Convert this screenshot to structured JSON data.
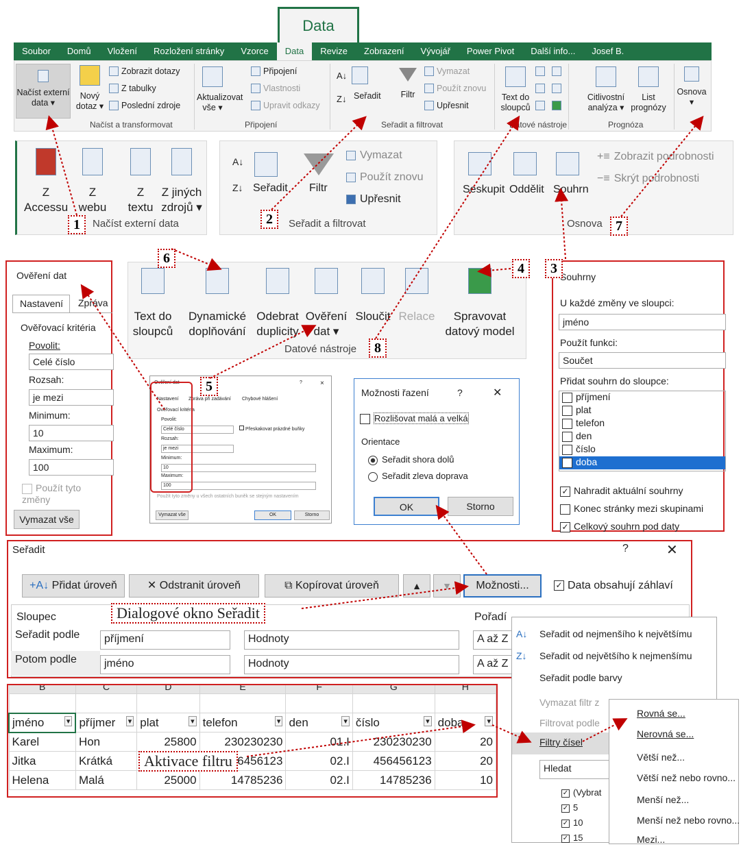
{
  "ribbon": {
    "data_tab_big": "Data",
    "tabs": [
      "Soubor",
      "Domů",
      "Vložení",
      "Rozložení stránky",
      "Vzorce",
      "Data",
      "Revize",
      "Zobrazení",
      "Vývojář",
      "Power Pivot",
      "Další info...",
      "Josef B."
    ],
    "btn_nacist": [
      "Načíst externí",
      "data ▾"
    ],
    "btn_novy": [
      "Nový",
      "dotaz ▾"
    ],
    "zobrazit_dotazy": "Zobrazit dotazy",
    "z_tabulky": "Z tabulky",
    "posledni_zdroje": "Poslední zdroje",
    "grp_nacist": "Načíst a transformovat",
    "btn_aktualizovat": [
      "Aktualizovat",
      "vše ▾"
    ],
    "pripojeni": "Připojení",
    "vlastnosti": "Vlastnosti",
    "upravit_odkazy": "Upravit odkazy",
    "grp_pripojeni": "Připojení",
    "seradit": "Seřadit",
    "filtr": "Filtr",
    "vymazat": "Vymazat",
    "pouzit_znovu": "Použít znovu",
    "upresnit": "Upřesnit",
    "grp_seradit": "Seřadit a filtrovat",
    "text_do_sloupcu": [
      "Text do",
      "sloupců"
    ],
    "grp_datove": "Datové nástroje",
    "citlivostni": [
      "Citlivostní",
      "analýza ▾"
    ],
    "list_prognozy": [
      "List",
      "prognózy"
    ],
    "grp_prognoza": "Prognóza",
    "osnova": "Osnova"
  },
  "p1": {
    "items": [
      [
        "Z",
        "Accessu"
      ],
      [
        "Z",
        "webu"
      ],
      [
        "Z",
        "textu"
      ],
      [
        "Z jiných",
        "zdrojů ▾"
      ]
    ],
    "label": "Načíst externí data",
    "num": "1"
  },
  "p2": {
    "seradit": "Seřadit",
    "filtr": "Filtr",
    "vymazat": "Vymazat",
    "pouzit_znovu": "Použít znovu",
    "upresnit": "Upřesnit",
    "label": "Seřadit a filtrovat",
    "num": "2"
  },
  "p7": {
    "seskupit": "Seskupit",
    "oddelit": "Oddělit",
    "souhrn": "Souhrn",
    "zobrazit": "Zobrazit podrobnosti",
    "skryt": "Skrýt podrobnosti",
    "label": "Osnova",
    "num": "7"
  },
  "p4": {
    "items": [
      [
        "Text do",
        "sloupců"
      ],
      [
        "Dynamické",
        "doplňování"
      ],
      [
        "Odebrat",
        "duplicity"
      ],
      [
        "Ověření",
        "dat ▾"
      ],
      [
        "Sloučit",
        ""
      ],
      [
        "Relace",
        ""
      ],
      [
        "Spravovat",
        "datový model"
      ]
    ],
    "label": "Datové nástroje",
    "num6": "6",
    "num4": "4",
    "num8": "8"
  },
  "overeni": {
    "title": "Ověření dat",
    "tab1": "Nastavení",
    "tab2": "Zpráva",
    "krit": "Ověřovací kritéria",
    "povolit": "Povolit:",
    "povolit_v": "Celé číslo",
    "rozsah": "Rozsah:",
    "rozsah_v": "je mezi",
    "min": "Minimum:",
    "min_v": "10",
    "max": "Maximum:",
    "max_v": "100",
    "pouzit": "Použít tyto změny",
    "vymazat": "Vymazat vše"
  },
  "small_dlg": {
    "title": "Ověření dat",
    "q": "?",
    "x": "×",
    "tabs": [
      "Nastavení",
      "Zpráva při zadávání",
      "Chybové hlášení"
    ],
    "krit": "Ověřovací kritéria",
    "povolit": "Povolit:",
    "povolit_v": "Celé číslo",
    "preskakovat": "Přeskakovat prázdné buňky",
    "rozsah": "Rozsah:",
    "rozsah_v": "je mezi",
    "min": "Minimum:",
    "min_v": "10",
    "max": "Maximum:",
    "max_v": "100",
    "pouzit": "Použít tyto změny u všech ostatních buněk se stejným nastavením",
    "vymazat": "Vymazat vše",
    "ok": "OK",
    "storno": "Storno",
    "num": "5"
  },
  "moznosti": {
    "title": "Možnosti řazení",
    "q": "?",
    "x": "✕",
    "rozlisovat": "Rozlišovat malá a velká",
    "orientace": "Orientace",
    "r1": "Seřadit shora dolů",
    "r2": "Seřadit zleva doprava",
    "ok": "OK",
    "storno": "Storno"
  },
  "souhrny": {
    "title": "Souhrny",
    "num": "3",
    "u_kazde": "U každé změny ve sloupci:",
    "u_kazde_v": "jméno",
    "pouzit": "Použít funkci:",
    "pouzit_v": "Součet",
    "pridat": "Přidat souhrn do sloupce:",
    "cols": [
      "příjmení",
      "plat",
      "telefon",
      "den",
      "číslo",
      "doba"
    ],
    "nahradit": "Nahradit aktuální souhrny",
    "konec": "Konec stránky mezi skupinami",
    "celkovy": "Celkový souhrn pod daty"
  },
  "seradit_dlg": {
    "title": "Seřadit",
    "q": "?",
    "x": "✕",
    "pridat": "Přidat úroveň",
    "odstranit": "Odstranit úroveň",
    "kopirovat": "Kopírovat úroveň",
    "moznosti": "Možnosti...",
    "zahlavi": "Data obsahují záhlaví",
    "sloupec": "Sloupec",
    "poradi": "Pořadí",
    "r1": [
      "Seřadit podle",
      "příjmení",
      "Hodnoty",
      "A až Z"
    ],
    "r2": [
      "Potom podle",
      "jméno",
      "Hodnoty",
      "A až Z"
    ],
    "ann": "Dialogové okno Seřadit"
  },
  "sheet": {
    "cols": [
      "B",
      "C",
      "D",
      "E",
      "F",
      "G",
      "H"
    ],
    "headers": [
      "jméno",
      "příjmer",
      "plat",
      "telefon",
      "den",
      "číslo",
      "doba"
    ],
    "rows": [
      [
        "Karel",
        "Hon",
        "25800",
        "230230230",
        "01.I",
        "230230230",
        "20"
      ],
      [
        "Jitka",
        "Krátká",
        "",
        "456456123",
        "02.I",
        "456456123",
        "20"
      ],
      [
        "Helena",
        "Malá",
        "25000",
        "14785236",
        "02.I",
        "14785236",
        "10"
      ]
    ],
    "ann": "Aktivace filtru"
  },
  "filter_menu": {
    "items": [
      "Seřadit od nejmenšího k největšímu",
      "Seřadit od největšího k nejmenšímu",
      "Seřadit podle barvy",
      "Vymazat filtr z",
      "Filtrovat podle",
      "Filtry čísel",
      "Hledat"
    ],
    "checks": [
      "(Vybrat",
      "5",
      "10",
      "15"
    ]
  },
  "sub_menu": {
    "items": [
      "Rovná se...",
      "Nerovná se...",
      "Větší než...",
      "Větší než nebo rovno...",
      "Menší než...",
      "Menší než nebo rovno...",
      "Mezi..."
    ]
  },
  "colors": {
    "excel_green": "#217346",
    "annotation_red": "#c00000"
  }
}
